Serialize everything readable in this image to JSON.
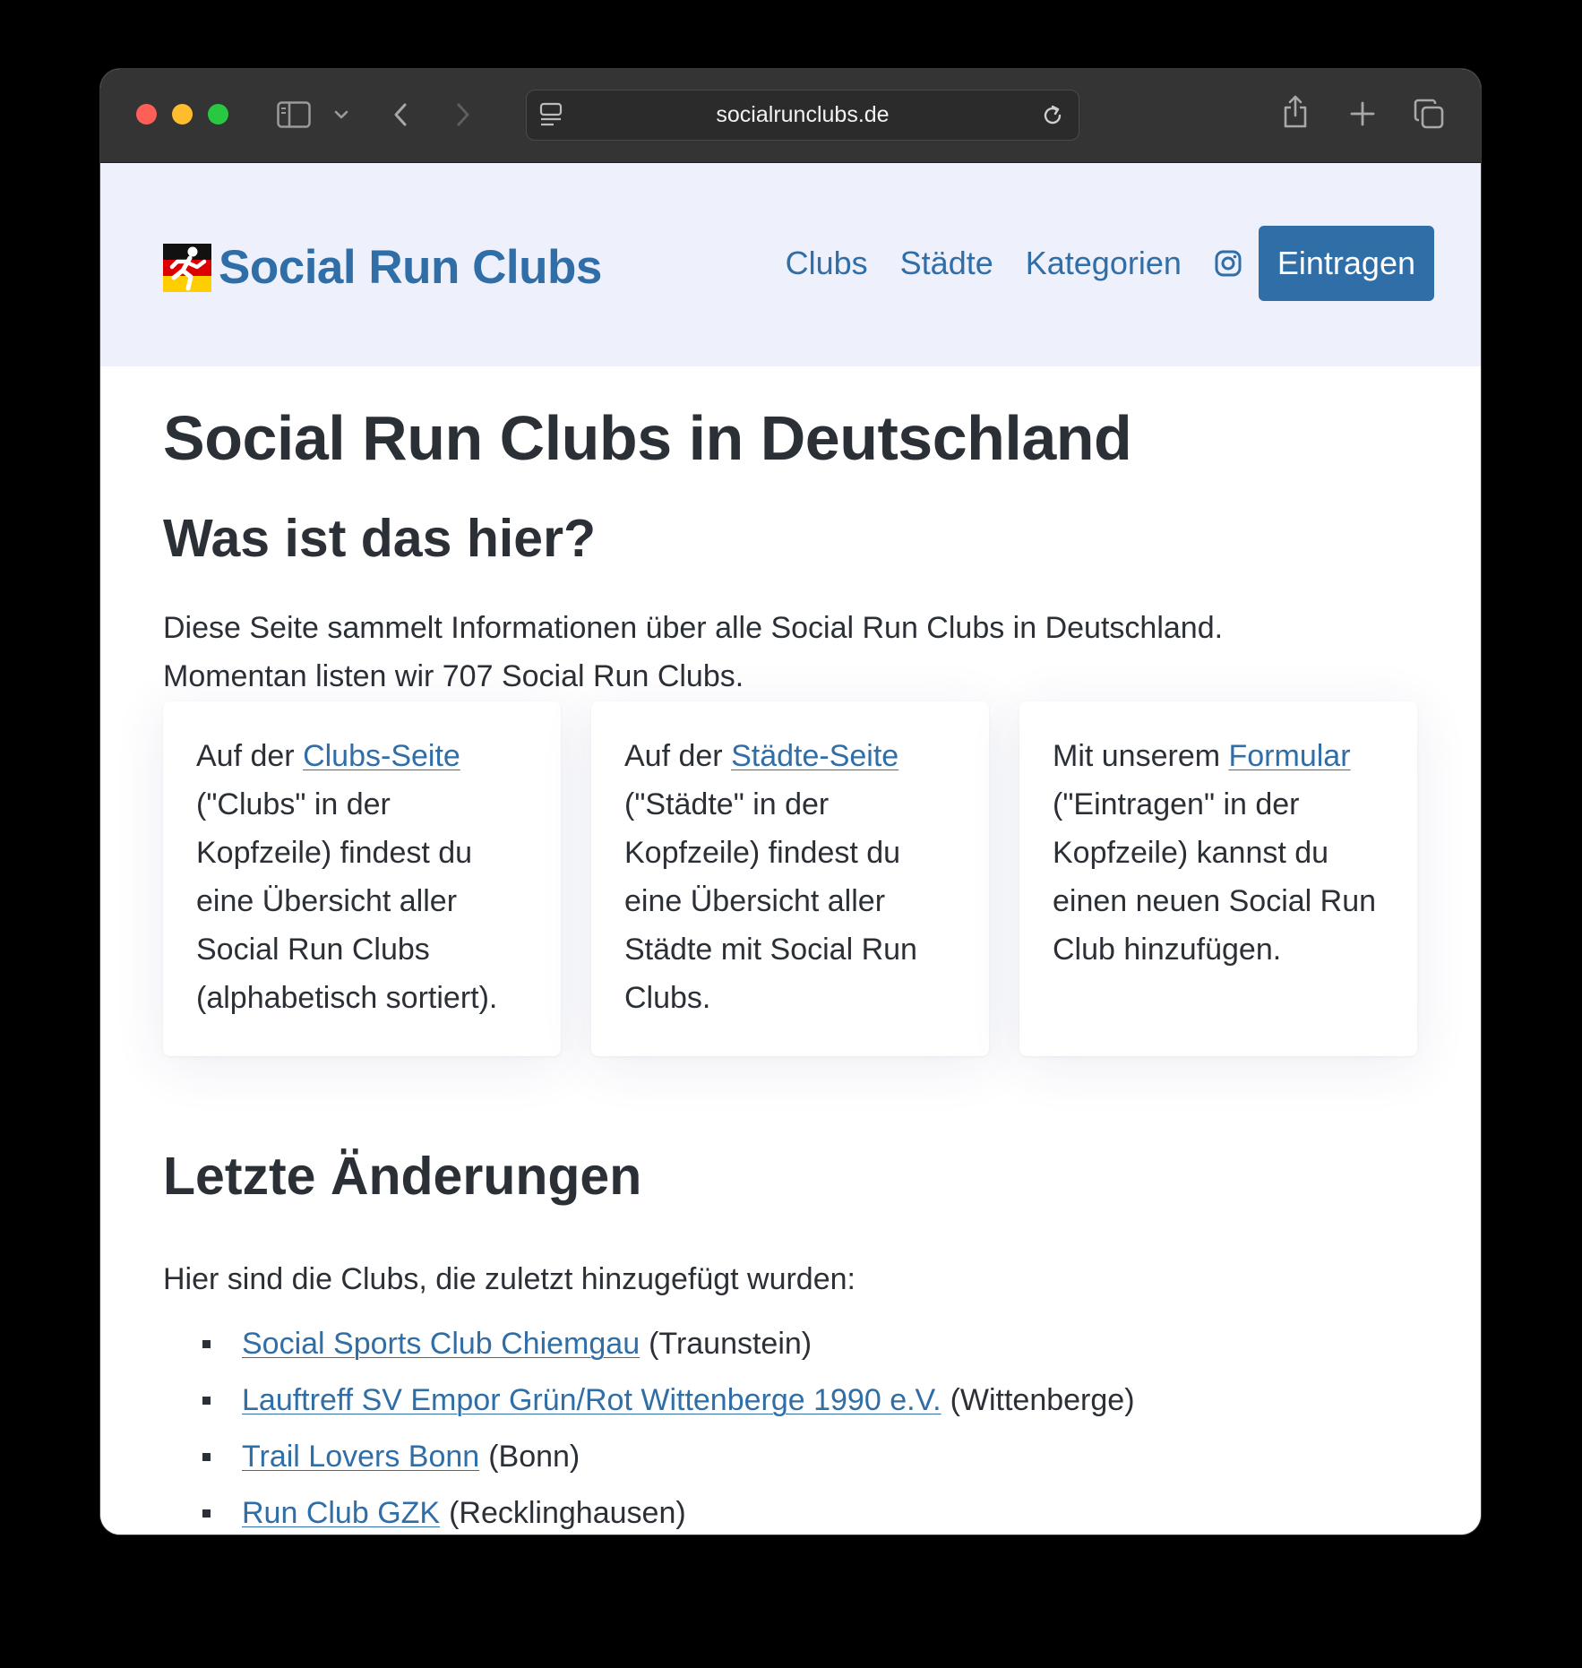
{
  "browser": {
    "url": "socialrunclubs.de"
  },
  "header": {
    "brand": "Social Run Clubs",
    "nav": [
      "Clubs",
      "Städte",
      "Kategorien"
    ],
    "cta": "Eintragen",
    "colors": {
      "accent": "#2f6ea7",
      "header_bg": "#eef0fc"
    }
  },
  "main": {
    "title": "Social Run Clubs in Deutschland",
    "about": {
      "heading": "Was ist das hier?",
      "line1": "Diese Seite sammelt Informationen über alle Social Run Clubs in Deutschland.",
      "line2": "Momentan listen wir 707 Social Run Clubs."
    },
    "cards": [
      {
        "pre": "Auf der ",
        "link": "Clubs-Seite",
        "post": " (\"Clubs\" in der Kopfzeile) findest du eine Übersicht aller Social Run Clubs (alphabetisch sortiert)."
      },
      {
        "pre": "Auf der ",
        "link": "Städte-Seite",
        "post": " (\"Städte\" in der Kopfzeile) findest du eine Übersicht aller Städte mit Social Run Clubs."
      },
      {
        "pre": "Mit unserem ",
        "link": "Formular",
        "post": " (\"Eintragen\" in der Kopfzeile) kannst du einen neuen Social Run Club hinzufügen."
      }
    ],
    "latest": {
      "heading": "Letzte Änderungen",
      "intro": "Hier sind die Clubs, die zuletzt hinzugefügt wurden:",
      "items": [
        {
          "name": "Social Sports Club Chiemgau",
          "city": "(Traunstein)"
        },
        {
          "name": "Lauftreff SV Empor Grün/Rot Wittenberge 1990 e.V.",
          "city": "(Wittenberge)"
        },
        {
          "name": "Trail Lovers Bonn",
          "city": "(Bonn)"
        },
        {
          "name": "Run Club GZK",
          "city": "(Recklinghausen)"
        }
      ]
    }
  }
}
